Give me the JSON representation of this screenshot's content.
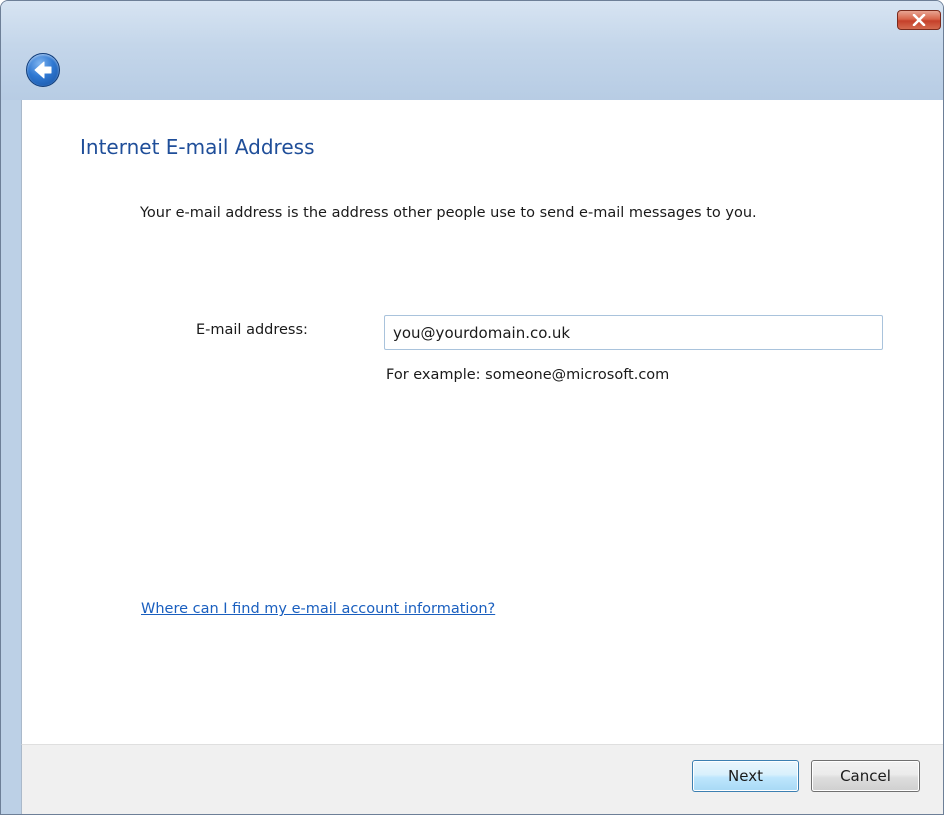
{
  "wizard": {
    "close_label": "Close",
    "back_label": "Back"
  },
  "page": {
    "title": "Internet E-mail Address",
    "description": "Your e-mail address is the address other people use to send e-mail messages to you."
  },
  "form": {
    "email_label": "E-mail address:",
    "email_value": "you@yourdomain.co.uk",
    "example_text": "For example: someone@microsoft.com"
  },
  "help": {
    "link_text": "Where can I find my e-mail account information?"
  },
  "footer": {
    "next_label": "Next",
    "cancel_label": "Cancel"
  },
  "icons": {
    "close": "close-icon",
    "back": "back-arrow-icon"
  },
  "colors": {
    "title_blue": "#1f4e99",
    "link_blue": "#1a5fbf",
    "close_red": "#c5402a",
    "back_blue": "#2f78d2"
  }
}
